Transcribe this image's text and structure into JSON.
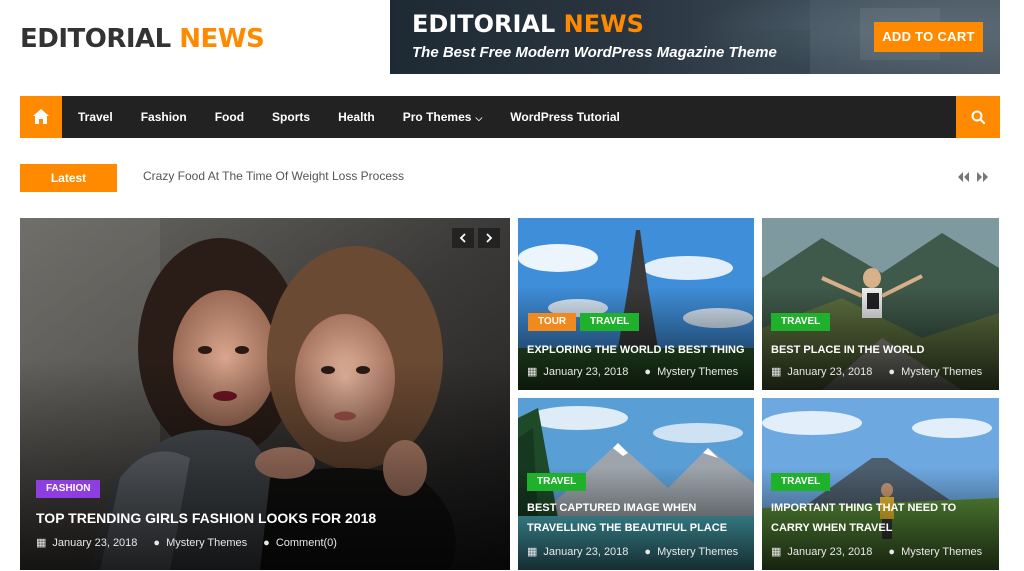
{
  "header": {
    "logo": {
      "part1": "EDITORIAL ",
      "part2": "NEWS"
    },
    "banner": {
      "title_part1": "EDITORIAL ",
      "title_part2": "NEWS",
      "subtitle": "The Best Free Modern WordPress Magazine Theme",
      "cta_label": "ADD TO CART"
    }
  },
  "nav": {
    "home_icon": "home-icon",
    "search_icon": "search-icon",
    "items": [
      {
        "label": "Travel"
      },
      {
        "label": "Fashion"
      },
      {
        "label": "Food"
      },
      {
        "label": "Sports"
      },
      {
        "label": "Health"
      },
      {
        "label": "Pro Themes",
        "dropdown": true
      },
      {
        "label": "WordPress Tutorial"
      }
    ]
  },
  "ticker": {
    "label": "Latest",
    "headline": "Crazy Food At The Time Of Weight Loss Process"
  },
  "featured": {
    "main": {
      "tag": "FASHION",
      "title": "TOP TRENDING GIRLS FASHION LOOKS FOR 2018",
      "date": "January 23, 2018",
      "author": "Mystery Themes",
      "comments": "Comment(0)"
    },
    "cards": [
      {
        "tags": [
          "TOUR",
          "TRAVEL"
        ],
        "title": "EXPLORING THE WORLD IS BEST THING",
        "date": "January 23, 2018",
        "author": "Mystery Themes"
      },
      {
        "tags": [
          "TRAVEL"
        ],
        "title": "BEST PLACE IN THE WORLD",
        "date": "January 23, 2018",
        "author": "Mystery Themes"
      },
      {
        "tags": [
          "TRAVEL"
        ],
        "title": "BEST CAPTURED IMAGE WHEN TRAVELLING THE BEAUTIFUL PLACE",
        "date": "January 23, 2018",
        "author": "Mystery Themes"
      },
      {
        "tags": [
          "TRAVEL"
        ],
        "title": "IMPORTANT THING THAT NEED TO CARRY WHEN TRAVEL",
        "date": "January 23, 2018",
        "author": "Mystery Themes"
      }
    ]
  },
  "colors": {
    "accent": "#ff8a00",
    "nav_bg": "#222222",
    "tag_fashion": "#8e3de0",
    "tag_travel": "#1fb12c",
    "tag_tour": "#f0891e"
  }
}
